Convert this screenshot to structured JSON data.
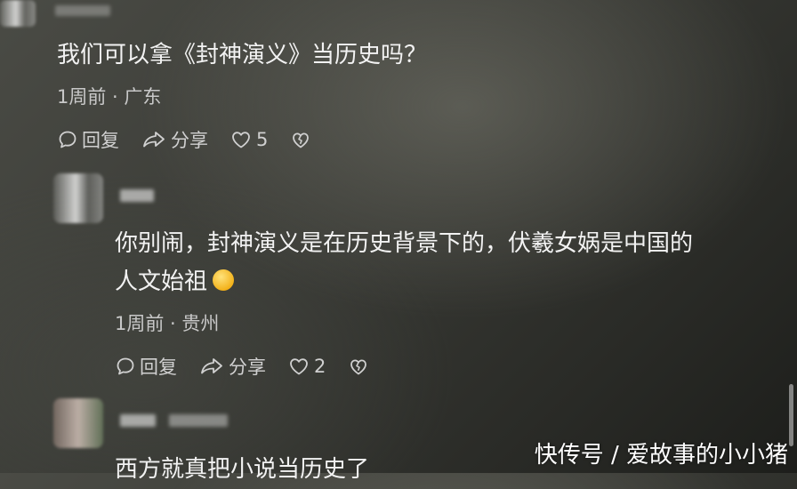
{
  "comments": [
    {
      "text": "我们可以拿《封神演义》当历史吗？",
      "meta": "1周前 · 广东",
      "reply_label": "回复",
      "share_label": "分享",
      "likes": "5"
    },
    {
      "text_line1": "你别闹，封神演义是在历史背景下的，伏羲女娲是中国的",
      "text_line2": "人文始祖",
      "emoji": "laughing-crying-emoji",
      "meta": "1周前 · 贵州",
      "reply_label": "回复",
      "share_label": "分享",
      "likes": "2"
    },
    {
      "text_partial": "西方就真把小说当历史了"
    }
  ],
  "watermark": "快传号 / 爱故事的小小猪",
  "icons": {
    "reply": "comment-icon",
    "share": "share-arrow-icon",
    "like": "heart-icon",
    "dislike": "broken-heart-icon"
  }
}
